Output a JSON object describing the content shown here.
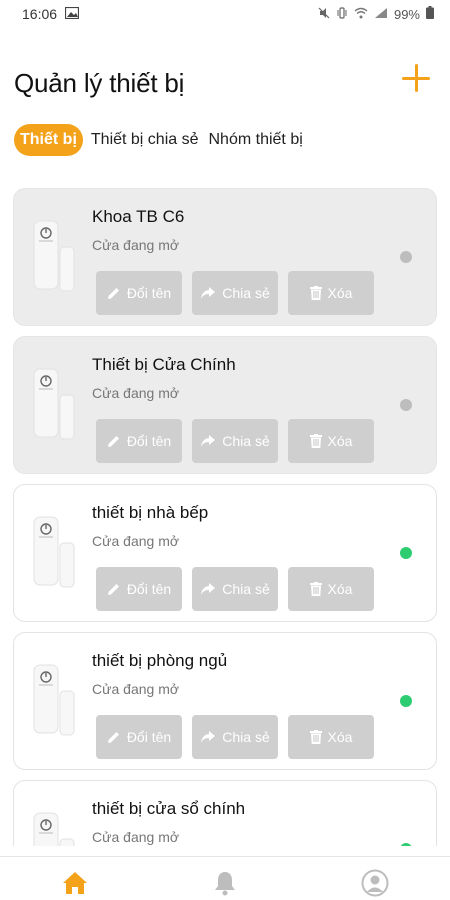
{
  "status_bar": {
    "time": "16:06",
    "battery": "99%",
    "icons": [
      "image-icon",
      "mute-icon",
      "vibrate-icon",
      "wifi-icon",
      "signal-icon",
      "battery-icon"
    ]
  },
  "header": {
    "title": "Quản lý thiết bị",
    "add_icon": "plus-icon"
  },
  "tabs": [
    {
      "label": "Thiết bị",
      "active": true
    },
    {
      "label": "Thiết bị chia sẻ",
      "active": false
    },
    {
      "label": "Nhóm thiết bị",
      "active": false
    }
  ],
  "devices": [
    {
      "name": "Khoa TB C6",
      "status": "Cửa đang mở",
      "online": false
    },
    {
      "name": "Thiết bị Cửa Chính",
      "status": "Cửa đang mở",
      "online": false
    },
    {
      "name": "thiết bị nhà bếp",
      "status": "Cửa đang mở",
      "online": true
    },
    {
      "name": "thiết bị phòng ngủ",
      "status": "Cửa đang mở",
      "online": true
    },
    {
      "name": "thiết bị cửa sổ chính",
      "status": "Cửa đang mở",
      "online": true
    }
  ],
  "actions": {
    "rename": "Đổi tên",
    "share": "Chia sẻ",
    "delete": "Xóa"
  },
  "colors": {
    "accent": "#f5a21b",
    "online": "#2ecc71",
    "offline": "#bdbdbd",
    "button_bg": "#cfcfcf"
  },
  "bottom_nav": [
    {
      "icon": "home-icon",
      "active": true
    },
    {
      "icon": "bell-icon",
      "active": false
    },
    {
      "icon": "profile-icon",
      "active": false
    }
  ]
}
